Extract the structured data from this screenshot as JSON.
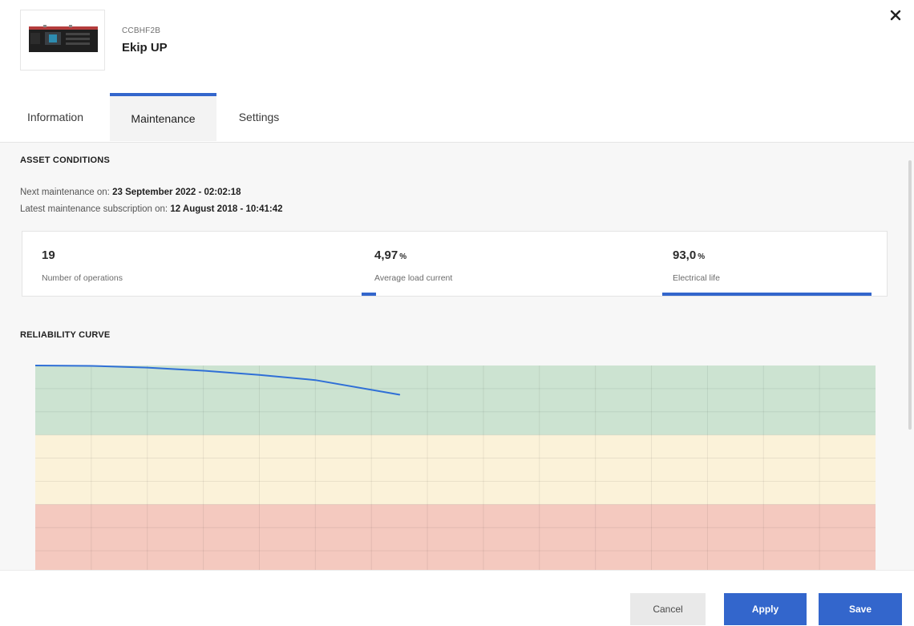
{
  "header": {
    "device_code": "CCBHF2B",
    "device_name": "Ekip UP",
    "close_icon": "close-icon"
  },
  "tabs": [
    {
      "label": "Information",
      "active": false
    },
    {
      "label": "Maintenance",
      "active": true
    },
    {
      "label": "Settings",
      "active": false
    }
  ],
  "asset_conditions": {
    "title": "ASSET CONDITIONS",
    "next_maintenance_label": "Next maintenance on:",
    "next_maintenance_value": "23 September 2022 - 02:02:18",
    "latest_subscription_label": "Latest maintenance subscription on:",
    "latest_subscription_value": "12 August 2018 - 10:41:42",
    "stats": [
      {
        "value": "19",
        "unit": "",
        "label": "Number of operations",
        "level": null
      },
      {
        "value": "4,97",
        "unit": "%",
        "label": "Average load current",
        "level": 0.0497
      },
      {
        "value": "93,0",
        "unit": "%",
        "label": "Electrical life",
        "level": 0.93
      }
    ]
  },
  "reliability": {
    "title": "RELIABILITY CURVE"
  },
  "chart_data": {
    "type": "line",
    "title": "",
    "xlabel": "",
    "ylabel": "",
    "grid": true,
    "ylim": [
      0,
      1
    ],
    "xlim": [
      0,
      15
    ],
    "bands": [
      {
        "from": 0.6667,
        "to": 1.0,
        "color": "#cce3d1"
      },
      {
        "from": 0.3333,
        "to": 0.6667,
        "color": "#fbf2d9"
      },
      {
        "from": 0.0,
        "to": 0.3333,
        "color": "#f4c9bf"
      }
    ],
    "series": [
      {
        "color": "#2f6fd6",
        "x": [
          0,
          1,
          2,
          3,
          4,
          5,
          6.5
        ],
        "y": [
          1.0,
          0.998,
          0.99,
          0.975,
          0.955,
          0.93,
          0.86
        ]
      }
    ]
  },
  "footer": {
    "cancel_label": "Cancel",
    "apply_label": "Apply",
    "save_label": "Save"
  },
  "colors": {
    "accent": "#3366cc"
  }
}
